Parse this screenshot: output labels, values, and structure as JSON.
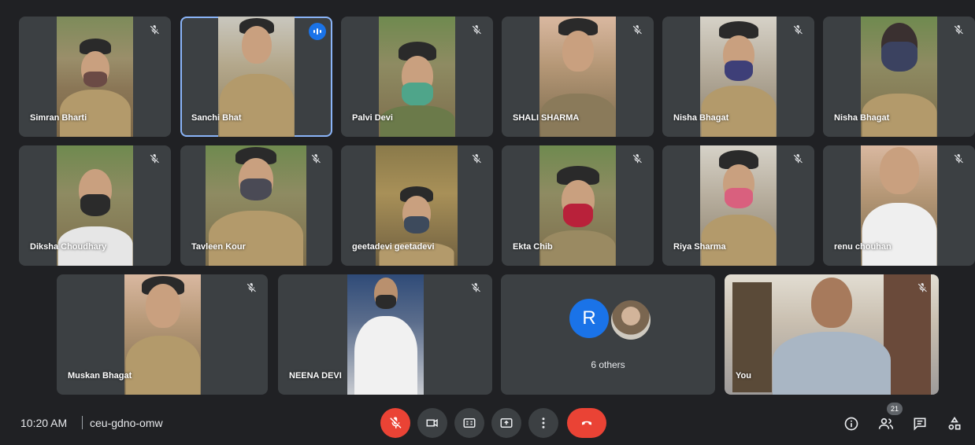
{
  "participants": [
    {
      "name": "Simran Bharti"
    },
    {
      "name": "Sanchi Bhat"
    },
    {
      "name": "Palvi Devi"
    },
    {
      "name": "SHALI SHARMA"
    },
    {
      "name": "Nisha Bhagat"
    },
    {
      "name": "Nisha Bhagat"
    },
    {
      "name": "Diksha Choudhary"
    },
    {
      "name": "Tavleen Kour"
    },
    {
      "name": "geetadevi geetadevi"
    },
    {
      "name": "Ekta Chib"
    },
    {
      "name": "Riya Sharma"
    },
    {
      "name": "renu chouhan"
    },
    {
      "name": "Muskan Bhagat"
    },
    {
      "name": "NEENA DEVI"
    },
    {
      "name": "You"
    }
  ],
  "others_tile": {
    "avatar_letter": "R",
    "label": "6 others"
  },
  "meeting": {
    "time": "10:20 AM",
    "code": "ceu-gdno-omw"
  },
  "people_count": "21",
  "colors": {
    "background": "#202124",
    "tile": "#3c4043",
    "accent": "#1a73e8",
    "danger": "#ea4335"
  },
  "icons": [
    "mic-off-icon",
    "camera-icon",
    "captions-icon",
    "present-icon",
    "more-options-icon",
    "hang-up-icon",
    "info-icon",
    "people-icon",
    "chat-icon",
    "activities-icon"
  ]
}
